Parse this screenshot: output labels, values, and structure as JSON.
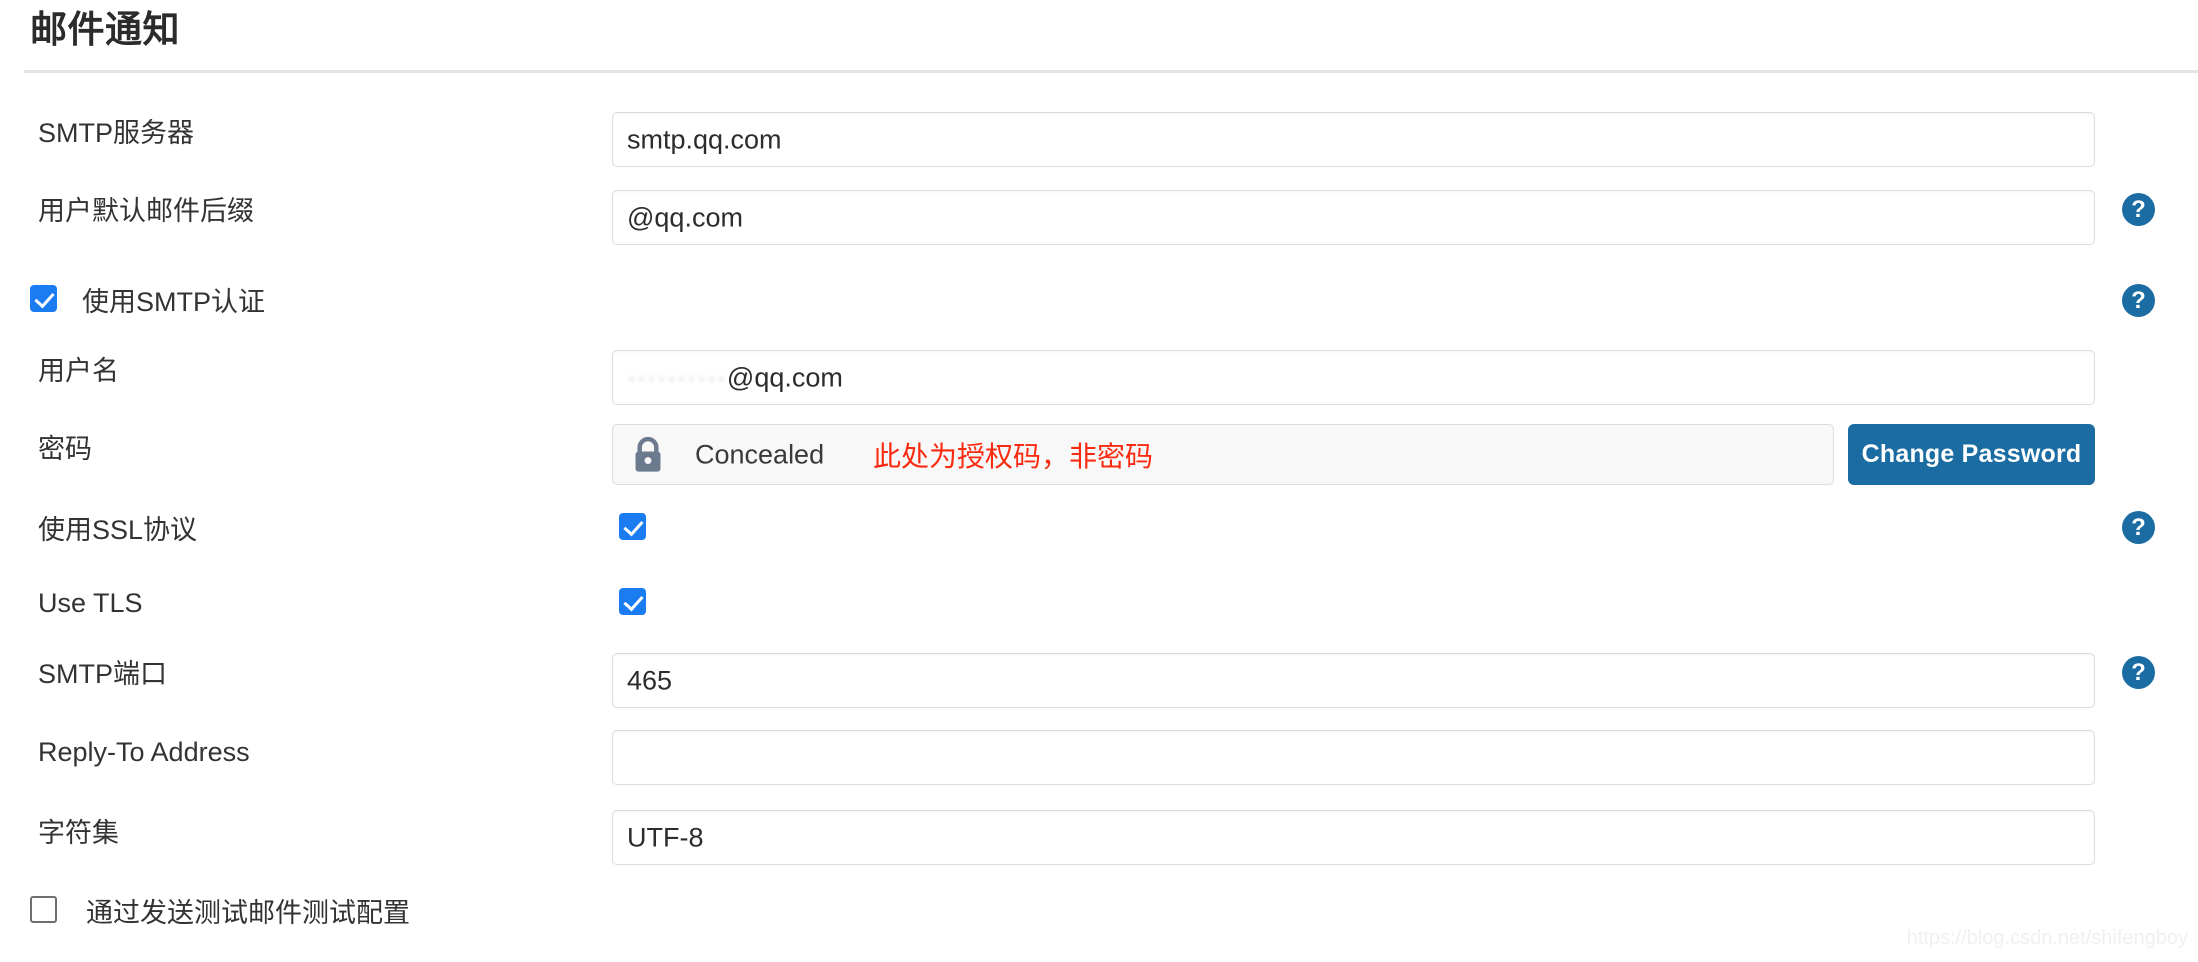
{
  "page": {
    "title": "邮件通知",
    "watermark": "https://blog.csdn.net/shifengboy"
  },
  "colors": {
    "accent_blue": "#1a6ca3",
    "checkbox_blue": "#1a7cf0",
    "note_red": "#fa2a10",
    "lock_grey": "#6b7a8d",
    "divider": "#e3e3e3",
    "field_border": "#dcdcdc"
  },
  "icons": {
    "help": "?",
    "lock": "lock-icon",
    "check": "✓"
  },
  "fields": {
    "smtp_server": {
      "label": "SMTP服务器",
      "value": "smtp.qq.com",
      "placeholder": "",
      "has_help": false
    },
    "mail_suffix": {
      "label": "用户默认邮件后缀",
      "value": "@qq.com",
      "placeholder": "",
      "has_help": true
    },
    "use_smtp_auth": {
      "label": "使用SMTP认证",
      "checked": true,
      "has_help": true
    },
    "username": {
      "label": "用户名",
      "value_masked": "··········",
      "value_suffix": "@qq.com",
      "placeholder": "",
      "has_help": false
    },
    "password": {
      "label": "密码",
      "concealed_text": "Concealed",
      "note": "此处为授权码，非密码",
      "button_label": "Change Password",
      "has_help": false
    },
    "use_ssl": {
      "label": "使用SSL协议",
      "checked": true,
      "has_help": true
    },
    "use_tls": {
      "label": "Use TLS",
      "checked": true,
      "has_help": false
    },
    "smtp_port": {
      "label": "SMTP端口",
      "value": "465",
      "placeholder": "",
      "has_help": true
    },
    "reply_to": {
      "label": "Reply-To Address",
      "value": "",
      "placeholder": "",
      "has_help": false
    },
    "charset": {
      "label": "字符集",
      "value": "UTF-8",
      "placeholder": "",
      "has_help": false
    },
    "test_mail": {
      "label": "通过发送测试邮件测试配置",
      "checked": false,
      "has_help": false
    }
  }
}
